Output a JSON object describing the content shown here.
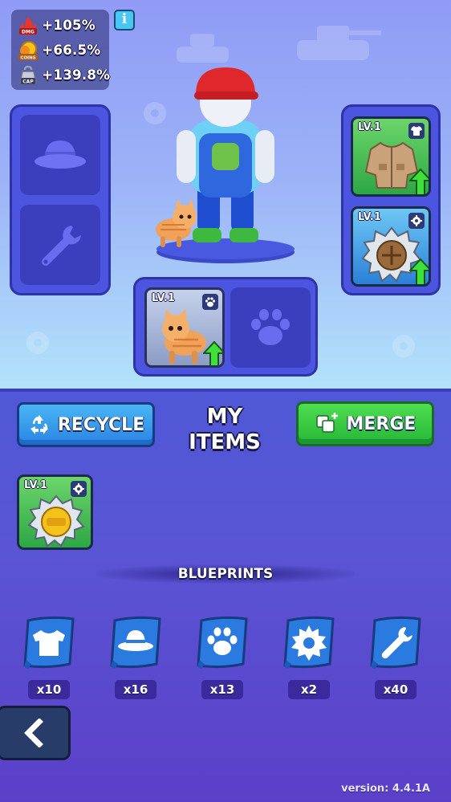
{
  "stats": [
    {
      "icon": "damage-icon",
      "tag": "DMG",
      "value": "+105%"
    },
    {
      "icon": "coins-icon",
      "tag": "COINS",
      "value": "+66.5%"
    },
    {
      "icon": "capacity-icon",
      "tag": "CAP",
      "value": "+139.8%"
    }
  ],
  "info_button": "i",
  "equipped": {
    "hat_slot": {
      "icon": "hat-icon",
      "empty": true
    },
    "tool_slot": {
      "icon": "wrench-icon",
      "empty": true
    },
    "outfit": {
      "level": "LV.1",
      "type": "shirt-icon",
      "upgradable": true
    },
    "gear": {
      "level": "LV.1",
      "type": "gear-icon",
      "upgradable": true
    },
    "pet": {
      "level": "LV.1",
      "type": "paw-icon",
      "upgradable": true
    },
    "pet_slot": {
      "icon": "paw-icon",
      "empty": true
    }
  },
  "actions": {
    "recycle_label": "RECYCLE",
    "merge_label": "MERGE"
  },
  "inventory": {
    "title_line1": "MY",
    "title_line2": "ITEMS",
    "items": [
      {
        "level": "LV.1",
        "type": "gear-icon",
        "name": "gold-saw-blade"
      }
    ]
  },
  "blueprints": {
    "title": "BLUEPRINTS",
    "items": [
      {
        "icon": "shirt-icon",
        "count": "x10"
      },
      {
        "icon": "hat-icon",
        "count": "x16"
      },
      {
        "icon": "paw-icon",
        "count": "x13"
      },
      {
        "icon": "gear-icon",
        "count": "x2"
      },
      {
        "icon": "wrench-icon",
        "count": "x40"
      }
    ]
  },
  "version": "version: 4.4.1A",
  "colors": {
    "recycle": "#2a84e2",
    "merge": "#25b837",
    "item_green": "#2da745",
    "item_blue": "#2b80d6"
  }
}
